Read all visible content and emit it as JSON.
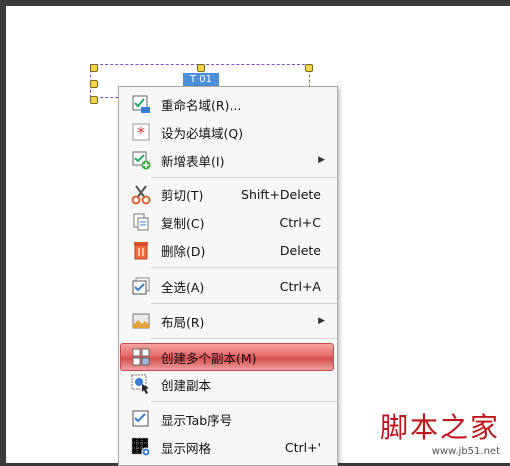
{
  "field": {
    "tag": "T 01"
  },
  "menu": {
    "items": [
      {
        "label": "重命名域(R)...",
        "shortcut": "",
        "icon": "rename-icon"
      },
      {
        "label": "设为必填域(Q)",
        "shortcut": "",
        "icon": "required-asterisk-icon"
      },
      {
        "label": "新增表单(I)",
        "shortcut": "",
        "icon": "new-form-icon",
        "submenu": true
      },
      {
        "label": "剪切(T)",
        "shortcut": "Shift+Delete",
        "icon": "scissors-icon"
      },
      {
        "label": "复制(C)",
        "shortcut": "Ctrl+C",
        "icon": "copy-icon"
      },
      {
        "label": "删除(D)",
        "shortcut": "Delete",
        "icon": "trash-icon"
      },
      {
        "label": "全选(A)",
        "shortcut": "Ctrl+A",
        "icon": "select-all-icon"
      },
      {
        "label": "布局(R)",
        "shortcut": "",
        "icon": "layout-icon",
        "submenu": true
      },
      {
        "label": "创建多个副本(M)",
        "shortcut": "",
        "icon": "multi-copy-icon",
        "highlighted": true
      },
      {
        "label": "创建副本",
        "shortcut": "",
        "icon": "duplicate-icon"
      },
      {
        "label": "显示Tab序号",
        "shortcut": "",
        "icon": "tab-order-icon"
      },
      {
        "label": "显示网格",
        "shortcut": "Ctrl+'",
        "icon": "grid-icon"
      }
    ]
  },
  "watermark": {
    "main": "脚本之家",
    "sub": "www.jb51.net"
  },
  "colors": {
    "highlight": "#d84e4e",
    "tag": "#4a90d9",
    "watermark": "#c0151a"
  }
}
